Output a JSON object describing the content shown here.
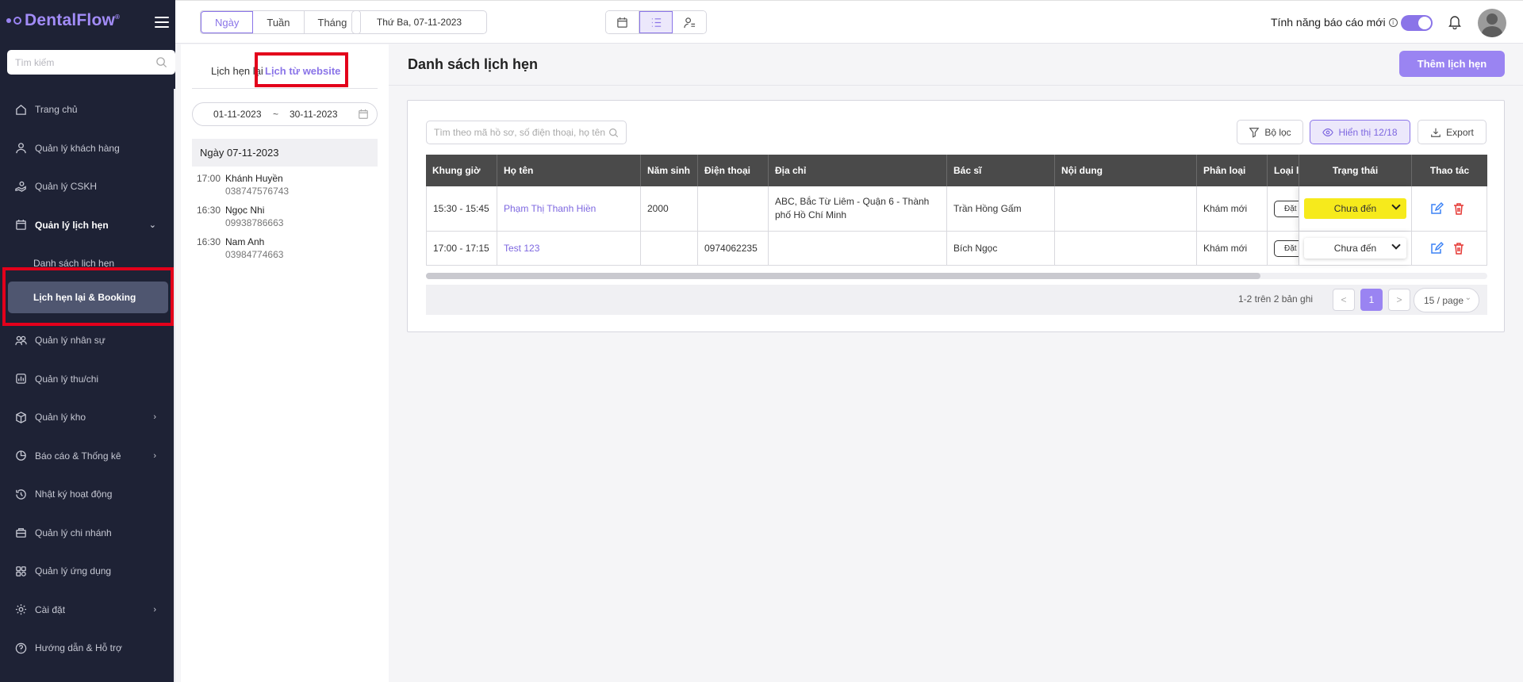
{
  "app": {
    "logo": "DentalFlow",
    "logo_mark": "®"
  },
  "sidebar": {
    "search_placeholder": "Tìm kiếm",
    "items": [
      {
        "label": "Trang chủ",
        "icon": "home-icon"
      },
      {
        "label": "Quản lý khách hàng",
        "icon": "user-icon"
      },
      {
        "label": "Quản lý CSKH",
        "icon": "care-icon"
      },
      {
        "label": "Quản lý lịch hẹn",
        "icon": "calendar-icon",
        "expanded": true
      },
      {
        "label": "Danh sách lịch hẹn"
      },
      {
        "label": "Lịch hẹn lại & Booking"
      },
      {
        "label": "Quản lý nhân sự",
        "icon": "team-icon"
      },
      {
        "label": "Quản lý thu/chi",
        "icon": "finance-icon"
      },
      {
        "label": "Quản lý kho",
        "icon": "box-icon"
      },
      {
        "label": "Báo cáo & Thống kê",
        "icon": "chart-icon"
      },
      {
        "label": "Nhật ký hoạt động",
        "icon": "history-icon"
      },
      {
        "label": "Quản lý chi nhánh",
        "icon": "branch-icon"
      },
      {
        "label": "Quản lý ứng dụng",
        "icon": "apps-icon"
      },
      {
        "label": "Cài đặt",
        "icon": "gear-icon"
      },
      {
        "label": "Hướng dẫn & Hỗ trợ",
        "icon": "help-icon"
      }
    ]
  },
  "topbar": {
    "views": [
      "Ngày",
      "Tuần",
      "Tháng"
    ],
    "current_date": "Thứ Ba, 07-11-2023",
    "report_label": "Tính năng báo cáo mới",
    "report_info": "i"
  },
  "leftpanel": {
    "tab_rebook": "Lịch hẹn lại",
    "tab_website": "Lịch từ website",
    "range_from": "01-11-2023",
    "range_sep": "~",
    "range_to": "30-11-2023",
    "day_heading": "Ngày 07-11-2023",
    "appointments": [
      {
        "time": "17:00",
        "name": "Khánh Huyền",
        "phone": "038747576743"
      },
      {
        "time": "16:30",
        "name": "Ngọc Nhi",
        "phone": "09938786663"
      },
      {
        "time": "16:30",
        "name": "Nam Anh",
        "phone": "03984774663"
      }
    ]
  },
  "main": {
    "title": "Danh sách lịch hẹn",
    "add_button": "Thêm lịch hẹn",
    "search_placeholder": "Tìm theo mã hồ sơ, số điện thoại, họ tên",
    "filter": "Bộ lọc",
    "show": "Hiển thị 12/18",
    "export": "Export",
    "columns": [
      "Khung giờ",
      "Họ tên",
      "Năm sinh",
      "Điện thoại",
      "Địa chỉ",
      "Bác sĩ",
      "Nội dung",
      "Phân loại",
      "Loại l",
      "Trạng thái",
      "Thao tác"
    ],
    "rows": [
      {
        "time": "15:30 - 15:45",
        "name": "Phạm Thị Thanh Hiền",
        "birth": "2000",
        "phone": "",
        "address": "ABC, Bắc Từ Liêm - Quận 6 - Thành phố Hồ Chí Minh",
        "doctor": "Trần Hồng Gấm",
        "content": "",
        "category": "Khám mới",
        "type": "Đặt",
        "status": "Chưa đến"
      },
      {
        "time": "17:00 - 17:15",
        "name": "Test 123",
        "birth": "",
        "phone": "0974062235",
        "address": "",
        "doctor": "Bích Ngọc",
        "content": "",
        "category": "Khám mới",
        "type": "Đặt",
        "status": "Chưa đến"
      }
    ],
    "pager": {
      "info": "1-2 trên 2 bản ghi",
      "prev": "<",
      "page": "1",
      "next": ">",
      "per_page": "15 / page"
    }
  },
  "colors": {
    "accent": "#9a84f2",
    "sidebar": "#1e2235",
    "status_yellow": "#f6ea1c",
    "highlight": "#e3001b"
  }
}
